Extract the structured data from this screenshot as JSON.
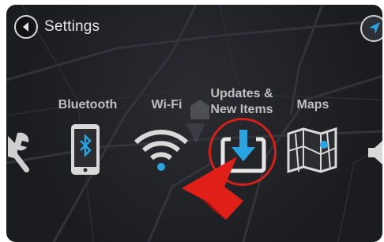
{
  "header": {
    "title": "Settings",
    "back_icon": "chevron-left-icon",
    "nav_icon": "navigation-arrow-icon"
  },
  "menu": {
    "items": [
      {
        "label": "",
        "icon": "wrench-icon"
      },
      {
        "label": "Bluetooth",
        "icon": "bluetooth-phone-icon"
      },
      {
        "label": "Wi-Fi",
        "icon": "wifi-icon"
      },
      {
        "label_line1": "Updates &",
        "label_line2": "New Items",
        "icon": "download-updates-icon",
        "highlighted": true
      },
      {
        "label": "Maps",
        "icon": "map-icon"
      },
      {
        "label": "",
        "icon": "speaker-icon"
      }
    ]
  },
  "colors": {
    "accent_blue": "#2aa4e0",
    "highlight_red": "#d2211b",
    "icon_white": "#dcdcdc",
    "background": "#1f2126"
  }
}
